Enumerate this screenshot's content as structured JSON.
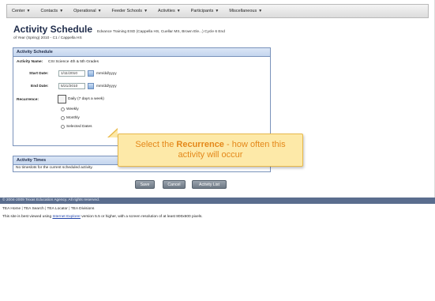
{
  "nav": {
    "items": [
      "Center",
      "Contacts",
      "Operational",
      "Feeder Schools",
      "Activities",
      "Participants",
      "Miscellaneous"
    ],
    "caret_items": [
      true,
      true,
      true,
      true,
      true,
      true,
      true
    ]
  },
  "header": {
    "title": "Activity Schedule",
    "context": "Edvance Training ESD (Cappella HS, Cuellar MS, Brown Ele...) Cycle 6 End",
    "subline": "of Year (Spring) 2010 - C1 / Cappella HS"
  },
  "schedule": {
    "heading": "Activity Schedule",
    "activity_name_label": "Activity Name:",
    "activity_name_value": "CSI Science 4th & 5th Grades",
    "start_label": "Start Date:",
    "start_value": "1/11/2010",
    "end_label": "End Date:",
    "end_value": "5/21/2010",
    "date_format": "mm/dd/yyyy",
    "recurrence_label": "Recurrence:",
    "options": [
      "Daily (7 days a week)",
      "Weekly",
      "Monthly",
      "Selected Dates"
    ]
  },
  "callout": {
    "prefix": "Select the ",
    "keyword": "Recurrence",
    "suffix": " - how often this",
    "line2": "activity will occur"
  },
  "times": {
    "heading": "Activity Times",
    "empty_text": "No timeslots for the current scheduled activity."
  },
  "buttons": {
    "save": "Save",
    "cancel": "Cancel",
    "activity_list": "Activity List"
  },
  "footer": {
    "copyright": "© 2004-2009 Texas Education Agency. All rights reserved.",
    "links": [
      "TEA Home",
      "TEA Search",
      "TEA Locator",
      "TEA Divisions"
    ],
    "best_prefix": "This site is best viewed using ",
    "best_link": "Internet Explorer",
    "best_suffix": " version 5.5 or higher, with a screen resolution of at least 800x600 pixels."
  }
}
